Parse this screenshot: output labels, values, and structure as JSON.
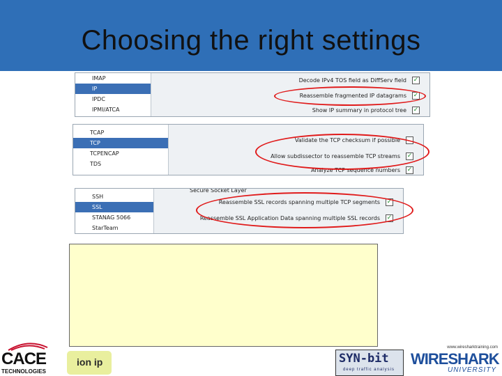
{
  "slide": {
    "title": "Choosing the right settings"
  },
  "panels": [
    {
      "tree": [
        "IMAP",
        "IP",
        "IPDC",
        "IPMI/ATCA"
      ],
      "selected": 1,
      "options": [
        {
          "label": "Decode IPv4 TOS field as DiffServ field",
          "checked": true
        },
        {
          "label": "Reassemble fragmented IP datagrams",
          "checked": true
        },
        {
          "label": "Show IP summary in protocol tree",
          "checked": true
        }
      ]
    },
    {
      "tree": [
        "TCAP",
        "TCP",
        "TCPENCAP",
        "TDS"
      ],
      "selected": 1,
      "options": [
        {
          "label": "Validate the TCP checksum if possible",
          "checked": false
        },
        {
          "label": "Allow subdissector to reassemble TCP streams",
          "checked": true
        },
        {
          "label": "Analyze TCP sequence numbers",
          "checked": true
        }
      ]
    },
    {
      "tree": [
        "SSH",
        "SSL",
        "STANAG 5066",
        "StarTeam"
      ],
      "selected": 1,
      "section": "Secure Socket Layer",
      "options": [
        {
          "label": "Reassemble SSL records spanning multiple TCP segments",
          "checked": true
        },
        {
          "label": "Reassemble SSL Application Data spanning multiple SSL records",
          "checked": true
        }
      ]
    }
  ],
  "logos": {
    "cace": {
      "word": "CACE",
      "sub": "TECHNOLOGIES"
    },
    "ionip": {
      "text": "ion ip"
    },
    "synbit": {
      "main": "SYN-bit",
      "tagline": "deep traffic analysis"
    },
    "wireshark": {
      "url": "www.wiresharktraining.com",
      "word": "WIRESHARK",
      "sub": "UNIVERSITY"
    }
  },
  "colors": {
    "header": "#2f6fb7",
    "highlight_ring": "#e01b1b",
    "notes_bg": "#ffffcc",
    "selection": "#3b6fb5"
  }
}
